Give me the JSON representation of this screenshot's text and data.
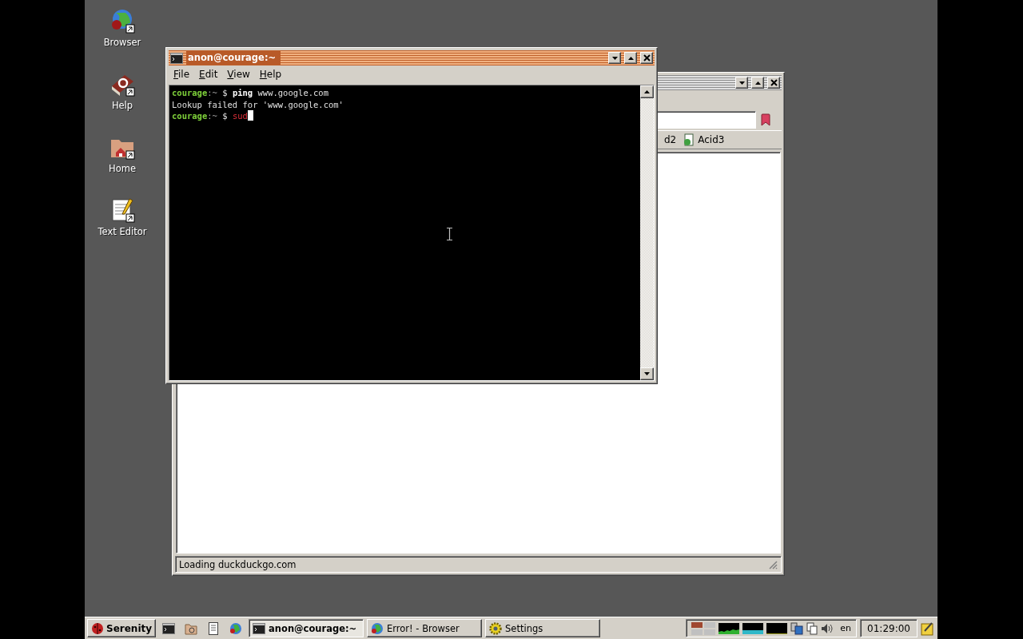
{
  "desktop_icons": [
    {
      "label": "Browser",
      "kind": "globe"
    },
    {
      "label": "Help",
      "kind": "book"
    },
    {
      "label": "Home",
      "kind": "folder"
    },
    {
      "label": "Text Editor",
      "kind": "editor"
    }
  ],
  "browser_window": {
    "active": false,
    "bookmarks": [
      {
        "label": "d2",
        "kind": "cut"
      },
      {
        "label": "Acid3",
        "kind": "page"
      }
    ],
    "status": "Loading duckduckgo.com"
  },
  "terminal_window": {
    "title": "anon@courage:~",
    "active": true,
    "menu": [
      "File",
      "Edit",
      "View",
      "Help"
    ],
    "cursor": true,
    "lines": [
      [
        {
          "text": "courage",
          "kind": "host"
        },
        {
          "text": ":~",
          "kind": "path"
        },
        {
          "text": " $ ",
          "kind": "plain"
        },
        {
          "text": "ping",
          "kind": "command"
        },
        {
          "text": " www.google.com",
          "kind": "plain"
        }
      ],
      [
        {
          "text": "Lookup failed for 'www.google.com'",
          "kind": "plain"
        }
      ],
      [
        {
          "text": "courage",
          "kind": "host"
        },
        {
          "text": ":~",
          "kind": "path"
        },
        {
          "text": " $ ",
          "kind": "plain"
        },
        {
          "text": "sud",
          "kind": "typed"
        }
      ]
    ]
  },
  "taskbar": {
    "start": "Serenity",
    "quick_launch": [
      {
        "kind": "terminal"
      },
      {
        "kind": "file-manager"
      },
      {
        "kind": "text-editor"
      },
      {
        "kind": "browser"
      }
    ],
    "tasks": [
      {
        "label": "anon@courage:~",
        "kind": "terminal",
        "selected": true
      },
      {
        "label": "Error! - Browser",
        "kind": "browser",
        "selected": false
      },
      {
        "label": "Settings",
        "kind": "settings",
        "selected": false
      }
    ],
    "tray_applets": [
      {
        "kind": "desktops"
      },
      {
        "kind": "cpu-graph"
      },
      {
        "kind": "net-graph"
      },
      {
        "kind": "mem-graph"
      },
      {
        "kind": "network"
      },
      {
        "kind": "clipboard"
      },
      {
        "kind": "volume"
      }
    ],
    "keymap": "en",
    "clock": "01:29:00"
  }
}
